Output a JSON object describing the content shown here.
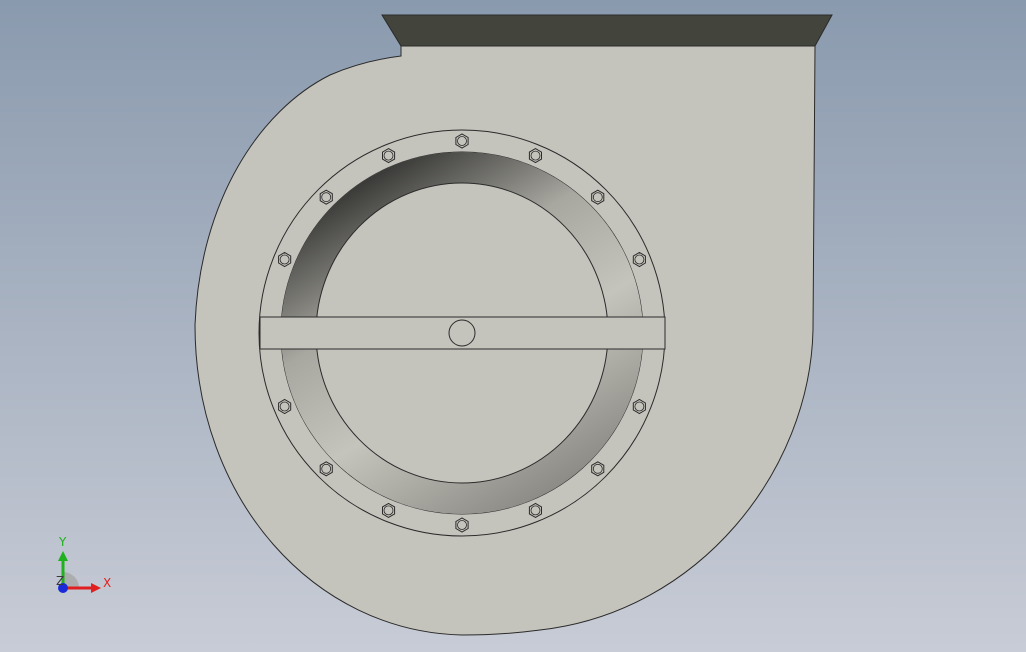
{
  "viewport": {
    "background_top": "#8a9aae",
    "background_bottom": "#c8ccd6"
  },
  "model": {
    "housing_color": "#c5c4bc",
    "outlet_flange_color": "#43453c",
    "edge_color": "#2a2a2a",
    "bolt_count": 16
  },
  "triad": {
    "y_label": "Y",
    "x_label": "X",
    "z_label": "Z",
    "y_color": "#20b020",
    "x_color": "#e02020",
    "z_color": "#1a2ad8"
  }
}
